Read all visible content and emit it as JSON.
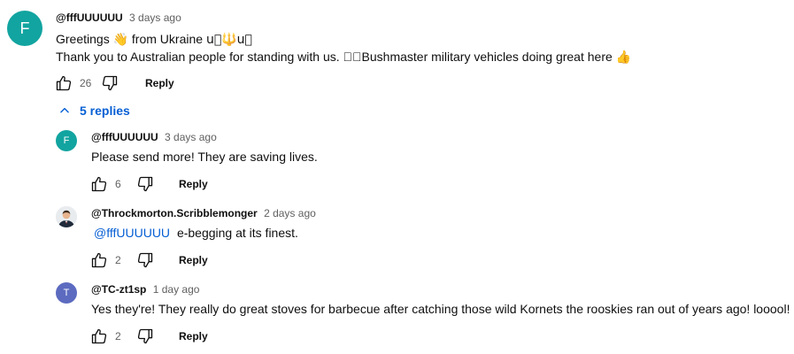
{
  "colors": {
    "avatar_teal": "#12a4a0",
    "avatar_purple": "#5c6bc0",
    "link_blue": "#065fd4",
    "meta_gray": "#606060"
  },
  "top_comment": {
    "avatar_letter": "F",
    "author": "@fffUUUUUU",
    "time": "3 days ago",
    "line1_prefix": "Greetings",
    "line1_wave": "👋",
    "line1_mid": "from Ukraine",
    "line1_suffix": "u\u0000🔱u\u0000",
    "line2_text": "Thank you to Australian people for standing with us. \u0000\u0000Bushmaster military vehicles doing great here",
    "line2_emoji": "👍",
    "likes": "26",
    "reply_label": "Reply"
  },
  "replies_toggle": {
    "label": "5 replies"
  },
  "replies": [
    {
      "avatar_letter": "F",
      "author": "@fffUUUUUU",
      "time": "3 days ago",
      "mention": "",
      "text": "Please send more! They are saving lives.",
      "likes": "6",
      "reply_label": "Reply"
    },
    {
      "avatar_letter": "",
      "author": "@Throckmorton.Scribblemonger",
      "time": "2 days ago",
      "mention": "@fffUUUUUU",
      "text": "e-begging at its finest.",
      "likes": "2",
      "reply_label": "Reply"
    },
    {
      "avatar_letter": "T",
      "author": "@TC-zt1sp",
      "time": "1 day ago",
      "mention": "",
      "text": "Yes they're! They really do great stoves for barbecue after catching those wild Kornets the rooskies ran out of years ago! looool!",
      "likes": "2",
      "reply_label": "Reply"
    }
  ]
}
